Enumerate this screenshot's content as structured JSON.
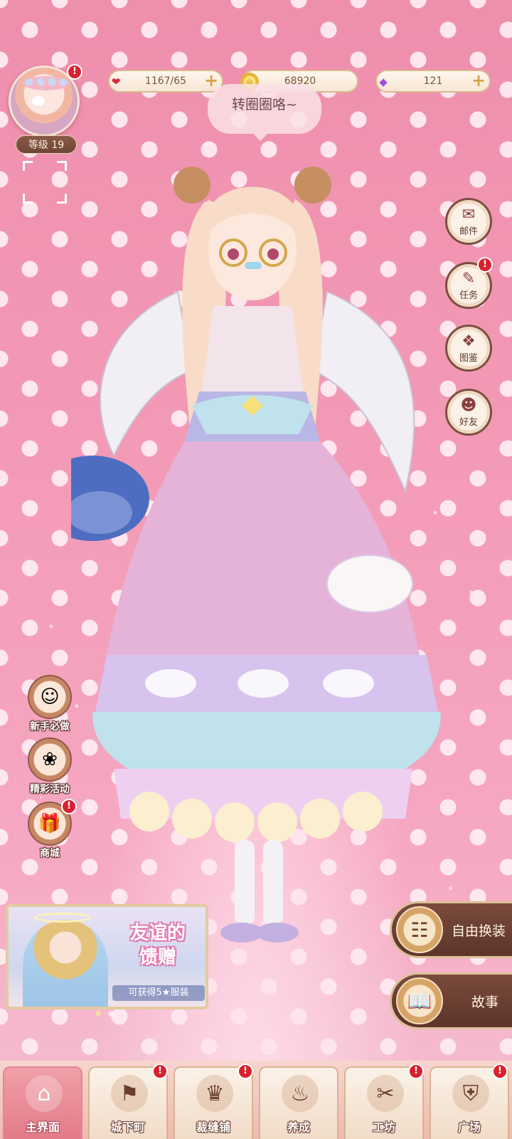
{
  "colors": {
    "badge": "#d9222f",
    "accent_brown": "#6f4535",
    "bg_pink": "#f19ab4"
  },
  "player": {
    "level_label": "等级",
    "level": "19",
    "avatar_icon": "player-avatar"
  },
  "resources": [
    {
      "id": "stamina",
      "icon": "heart-icon",
      "glyph": "❤",
      "value": "1167/65"
    },
    {
      "id": "gold",
      "icon": "coin-icon",
      "glyph": "◎",
      "value": "68920"
    },
    {
      "id": "diamond",
      "icon": "gem-icon",
      "glyph": "◆",
      "value": "121"
    }
  ],
  "speech": "转圈圈咯~",
  "side_menu": [
    {
      "label": "邮件",
      "icon": "mail-icon",
      "glyph": "✉"
    },
    {
      "label": "任务",
      "icon": "quest-icon",
      "glyph": "✎"
    },
    {
      "label": "图鉴",
      "icon": "collection-icon",
      "glyph": "❖"
    },
    {
      "label": "好友",
      "icon": "friends-icon",
      "glyph": "☻"
    }
  ],
  "events": [
    {
      "label": "新手必做",
      "icon": "newbie-icon",
      "glyph": "☺"
    },
    {
      "label": "精彩活动",
      "icon": "event-gift-icon",
      "glyph": "❀"
    },
    {
      "label": "商城",
      "icon": "shop-icon",
      "glyph": "🎁"
    }
  ],
  "banner": {
    "title_line1": "友谊的",
    "title_line2": "馈赠",
    "subtitle": "可获得5★服装"
  },
  "big_buttons": [
    {
      "label": "自由换装",
      "icon": "wardrobe-icon",
      "glyph": "☷"
    },
    {
      "label": "故事",
      "icon": "book-icon",
      "glyph": "📖"
    }
  ],
  "nav": [
    {
      "label": "主界面",
      "icon": "home-icon",
      "glyph": "⌂"
    },
    {
      "label": "城下町",
      "icon": "town-flag-icon",
      "glyph": "⚑"
    },
    {
      "label": "裁缝铺",
      "icon": "dress-icon",
      "glyph": "♛"
    },
    {
      "label": "养成",
      "icon": "growth-icon",
      "glyph": "♨"
    },
    {
      "label": "工坊",
      "icon": "thread-spool-icon",
      "glyph": "✂"
    },
    {
      "label": "广场",
      "icon": "plaza-shield-icon",
      "glyph": "⛨"
    }
  ],
  "badge_text": "!"
}
